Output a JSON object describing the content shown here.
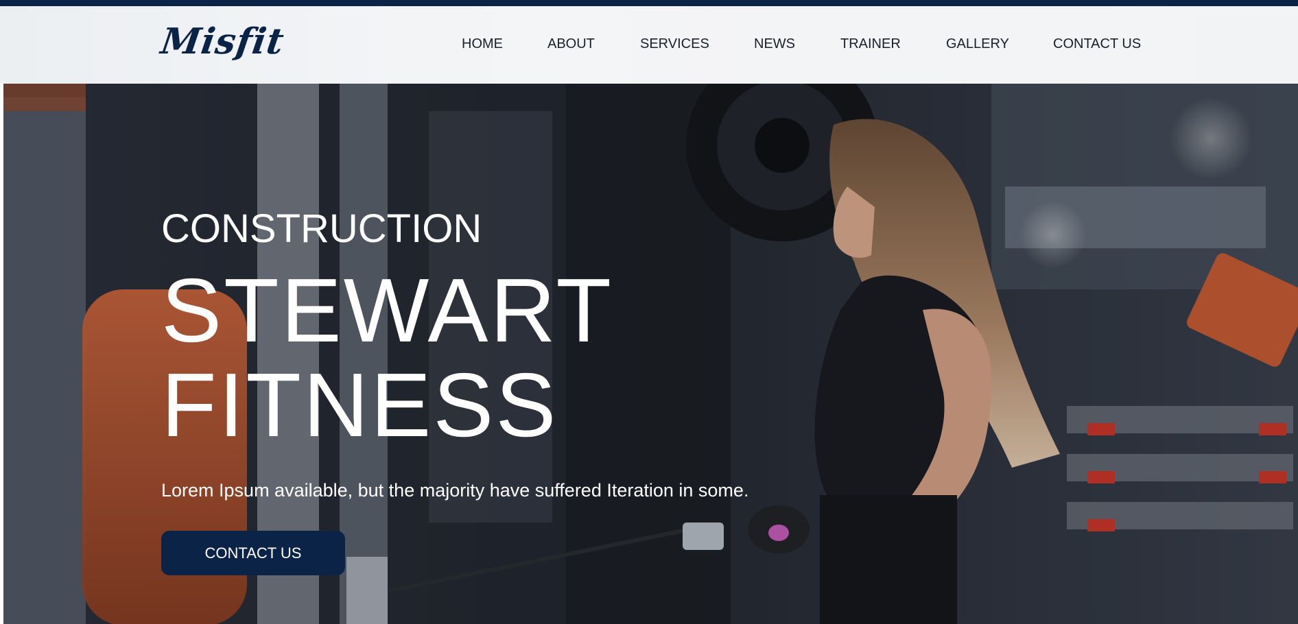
{
  "brand": {
    "logo_text": "Misfit",
    "accent_color": "#0b2346"
  },
  "nav": {
    "items": [
      {
        "label": "HOME"
      },
      {
        "label": "ABOUT"
      },
      {
        "label": "SERVICES"
      },
      {
        "label": "NEWS"
      },
      {
        "label": "TRAINER"
      },
      {
        "label": "GALLERY"
      },
      {
        "label": "CONTACT US"
      }
    ]
  },
  "hero": {
    "subtitle": "CONSTRUCTION",
    "title_line1": "STEWART",
    "title_line2": "FITNESS",
    "description": "Lorem Ipsum available, but the majority have suffered Iteration in some.",
    "cta_label": "CONTACT US"
  }
}
